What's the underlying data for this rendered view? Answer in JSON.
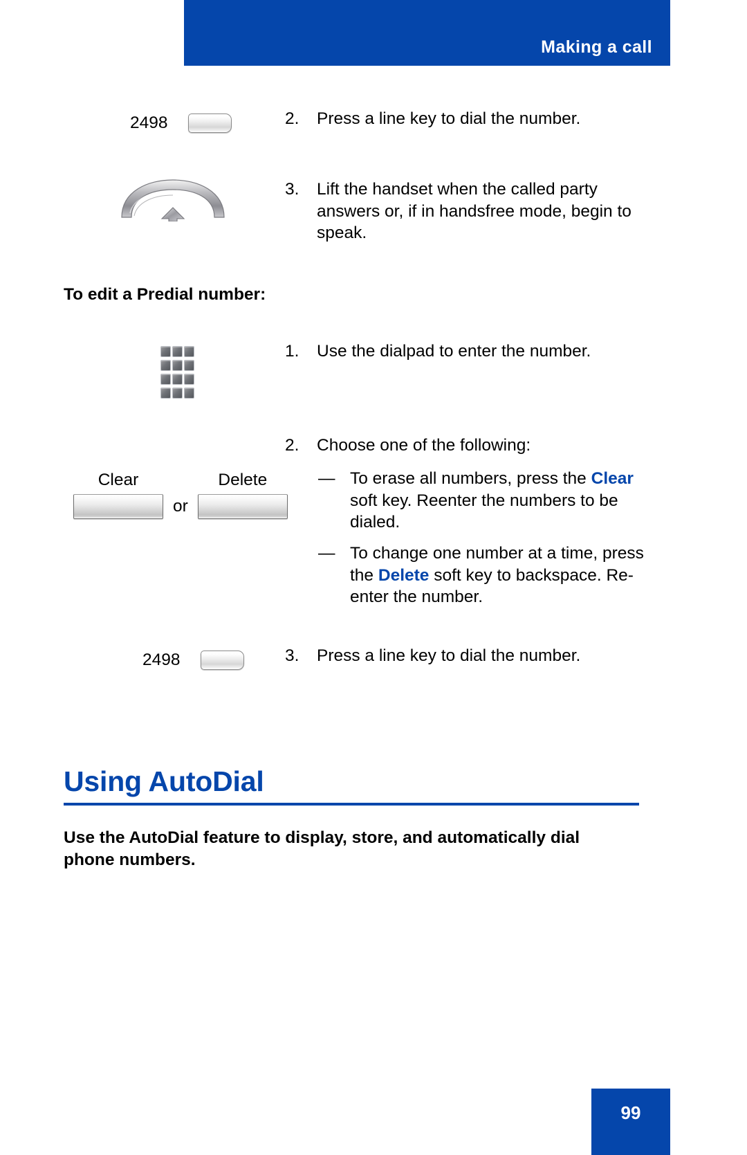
{
  "header": {
    "title": "Making a call",
    "banner_color": "#0546ab"
  },
  "steps_top": [
    {
      "number": "2.",
      "text": "Press a line key to dial the number.",
      "icon_label": "2498",
      "icon": "line-key"
    },
    {
      "number": "3.",
      "text": "Lift the handset when the called party answers or, if in handsfree mode, begin to speak.",
      "icon_label": "",
      "icon": "handset"
    }
  ],
  "subhead": "To edit a Predial number:",
  "steps_edit": [
    {
      "number": "1.",
      "text": "Use the dialpad to enter the number.",
      "icon": "dialpad"
    },
    {
      "number": "2.",
      "text": "Choose one of the following:",
      "icon": "none"
    },
    {
      "number": "3.",
      "text": "Press a line key to dial the number.",
      "icon_label": "2498",
      "icon": "line-key"
    }
  ],
  "bullets": [
    {
      "dash": "—",
      "prefix": "To erase all numbers, press the ",
      "keyword": "Clear",
      "suffix": " soft key. Reenter the numbers to be dialed."
    },
    {
      "dash": "—",
      "prefix": "To change one number at a time, press the ",
      "keyword": "Delete",
      "suffix": " soft key to backspace. Re-enter the number."
    }
  ],
  "softkeys": {
    "clear_label": "Clear",
    "delete_label": "Delete",
    "or_label": "or"
  },
  "section": {
    "heading": "Using AutoDial",
    "heading_color": "#0546ab",
    "intro": "Use the AutoDial feature to display, store, and automatically dial phone numbers."
  },
  "footer": {
    "page_number": "99"
  }
}
